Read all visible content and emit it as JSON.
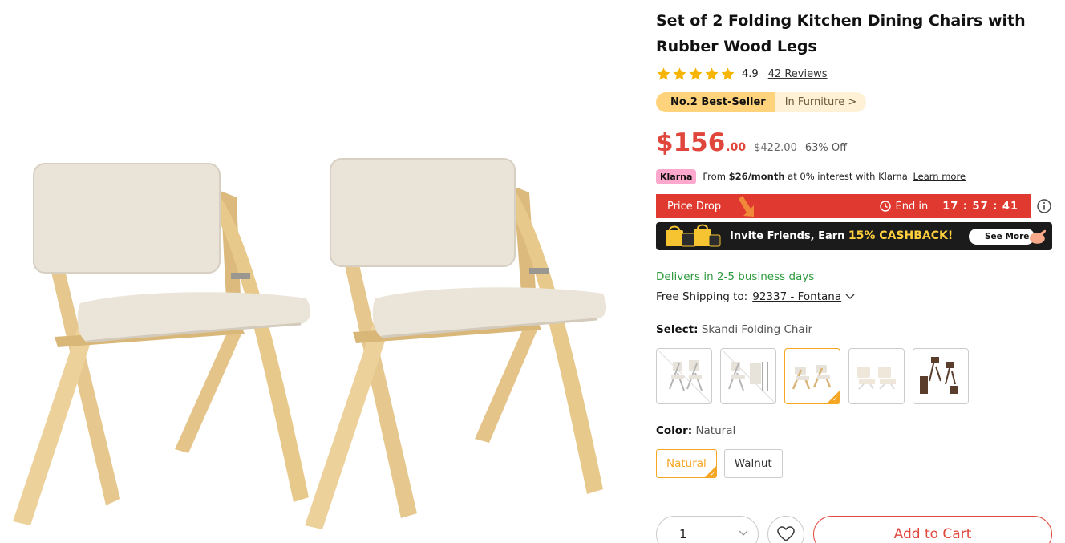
{
  "product": {
    "title": "Set of 2 Folding Kitchen Dining Chairs with Rubber Wood Legs",
    "rating": {
      "value": "4.9",
      "stars": 5,
      "reviews_label": "42 Reviews"
    },
    "bestseller": {
      "rank_label": "No.2 Best-Seller",
      "category_label": "In Furniture >"
    },
    "price": {
      "main": "$156",
      "cents": ".00",
      "original": "$422.00",
      "discount": "63% Off"
    },
    "klarna": {
      "badge": "Klarna",
      "prefix": "From ",
      "amount": "$26/month",
      "suffix": " at 0% interest with Klarna ",
      "learn_more": "Learn more"
    },
    "price_drop": {
      "label": "Price Drop",
      "end_label": "End in",
      "countdown": "17 : 57 : 41"
    },
    "invite_banner": {
      "text_prefix": "Invite Friends, Earn ",
      "highlight": "15% CASHBACK!",
      "button": "See More"
    },
    "delivery": {
      "eta": "Delivers in 2-5 business days",
      "shipping_prefix": "Free Shipping to:",
      "location": "92337 - Fontana"
    },
    "select": {
      "label": "Select:",
      "value": "Skandi Folding Chair",
      "variants": [
        "variant-1",
        "variant-2",
        "variant-3",
        "variant-4",
        "variant-5"
      ],
      "selected_index": 2
    },
    "color": {
      "label": "Color:",
      "value": "Natural",
      "options": [
        "Natural",
        "Walnut"
      ],
      "selected_index": 0
    },
    "cart": {
      "quantity": "1",
      "add_to_cart": "Add to Cart"
    }
  },
  "colors": {
    "accent_red": "#e0463b",
    "price_drop_bg": "#e0392f",
    "selected_orange": "#f5a623",
    "delivery_green": "#2e9a3e",
    "star_yellow": "#f7b500",
    "bestseller_gold": "#ffd37b",
    "klarna_pink": "#ffa8cd"
  },
  "icons": {
    "star": "star-icon",
    "clock": "clock-icon",
    "info": "info-icon",
    "chevron_down": "chevron-down-icon",
    "heart": "heart-icon",
    "check": "check-icon"
  }
}
